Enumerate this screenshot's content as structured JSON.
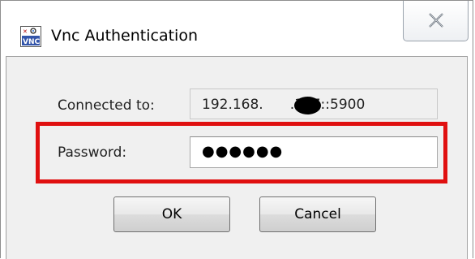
{
  "window": {
    "title": "Vnc Authentication",
    "app_icon": "vnc-icon",
    "close_icon": "close-icon"
  },
  "form": {
    "connected_label": "Connected to:",
    "connected_value": "192.168.",
    "connected_value_suffix": ".167::5900",
    "password_label": "Password:",
    "password_value": "●●●●●●"
  },
  "buttons": {
    "ok_label": "OK",
    "cancel_label": "Cancel"
  },
  "colors": {
    "highlight": "#e01010",
    "client_background": "#f0f0f0"
  }
}
